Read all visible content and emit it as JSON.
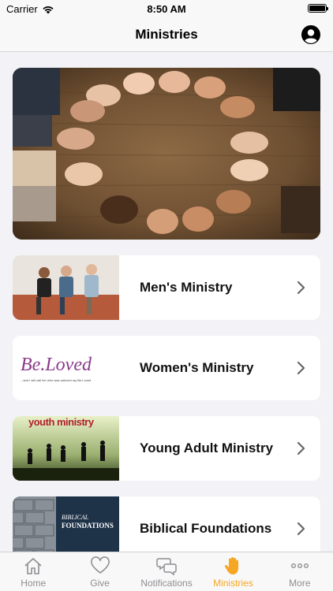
{
  "status_bar": {
    "carrier": "Carrier",
    "time": "8:50 AM"
  },
  "nav": {
    "title": "Ministries",
    "profile_icon": "person-circle-icon"
  },
  "hero": {
    "image": "hands-circle-photo"
  },
  "ministries": [
    {
      "label": "Men's Ministry",
      "thumb": "men-group-photo"
    },
    {
      "label": "Women's Ministry",
      "thumb_text": "Be.Loved",
      "thumb_caption": "...and I will call her who was unloved my Be.Loved"
    },
    {
      "label": "Young Adult Ministry",
      "thumb_text": "youth ministry"
    },
    {
      "label": "Biblical Foundations",
      "thumb_text_line1": "BIBLICAL",
      "thumb_text_line2": "FOUNDATIONS"
    }
  ],
  "tabs": [
    {
      "label": "Home",
      "icon": "house-icon",
      "active": false
    },
    {
      "label": "Give",
      "icon": "heart-icon",
      "active": false
    },
    {
      "label": "Notifications",
      "icon": "chat-bubbles-icon",
      "active": false
    },
    {
      "label": "Ministries",
      "icon": "hand-icon",
      "active": true
    },
    {
      "label": "More",
      "icon": "ellipsis-icon",
      "active": false
    }
  ],
  "colors": {
    "accent": "#f5a623",
    "inactive": "#8e8e93"
  }
}
